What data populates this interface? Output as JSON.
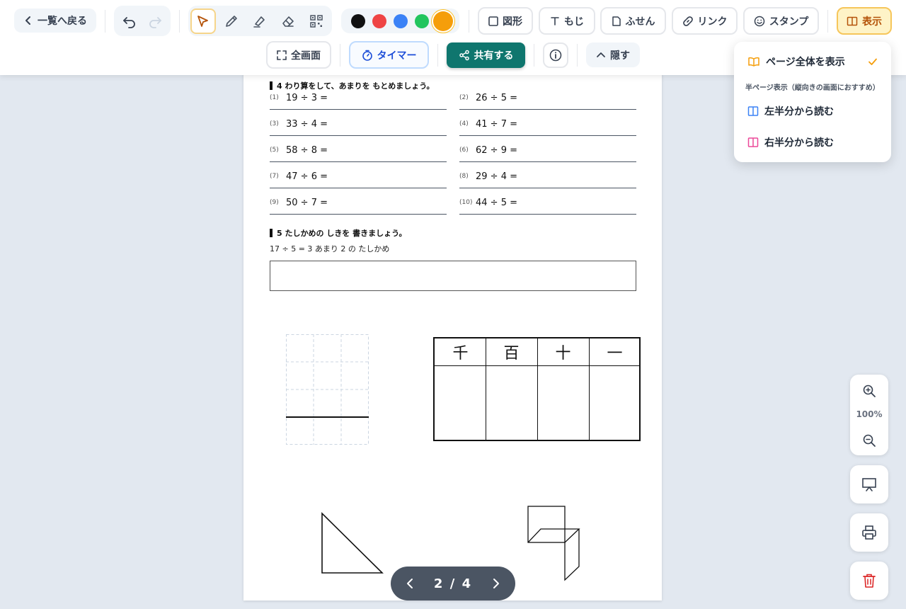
{
  "toolbar": {
    "back_label": "一覧へ戻る",
    "shape_label": "図形",
    "text_label": "もじ",
    "sticky_label": "ふせん",
    "link_label": "リンク",
    "stamp_label": "スタンプ",
    "display_label": "表示",
    "fullscreen_label": "全画面",
    "timer_label": "タイマー",
    "share_label": "共有する",
    "hide_label": "隠す",
    "colors": [
      "#111111",
      "#ef4444",
      "#3b82f6",
      "#22c55e",
      "#f59e0b"
    ],
    "selected_color": "#f59e0b",
    "tools": [
      "select-icon",
      "pencil-icon",
      "highlighter-icon",
      "eraser-icon",
      "qr-code-icon"
    ],
    "active_tool": "select-icon"
  },
  "dropdown": {
    "full_page": "ページ全体を表示",
    "sub_heading": "半ページ表示（縦向きの画面におすすめ）",
    "left_half": "左半分から読む",
    "right_half": "右半分から読む",
    "selected": "full_page"
  },
  "page": {
    "section4_title": "4 わり算をして、あまりを もとめましょう。",
    "problems": [
      {
        "num": "(1)",
        "expr": "19 ÷ 3 ="
      },
      {
        "num": "(2)",
        "expr": "26 ÷ 5 ="
      },
      {
        "num": "(3)",
        "expr": "33 ÷ 4 ="
      },
      {
        "num": "(4)",
        "expr": "41 ÷ 7 ="
      },
      {
        "num": "(5)",
        "expr": "58 ÷ 8 ="
      },
      {
        "num": "(6)",
        "expr": "62 ÷ 9 ="
      },
      {
        "num": "(7)",
        "expr": "47 ÷ 6 ="
      },
      {
        "num": "(8)",
        "expr": "29 ÷ 4 ="
      },
      {
        "num": "(9)",
        "expr": "50 ÷ 7 ="
      },
      {
        "num": "(10)",
        "expr": "44 ÷ 5 ="
      }
    ],
    "section5_title": "5 たしかめの しきを 書きましょう。",
    "section5_note": "17 ÷ 5 = 3 あまり 2 の たしかめ",
    "place_value_headers": [
      "千",
      "百",
      "十",
      "一"
    ]
  },
  "zoom": {
    "level": "100%"
  },
  "pager": {
    "current": "2",
    "total": "4",
    "separator": "/"
  }
}
